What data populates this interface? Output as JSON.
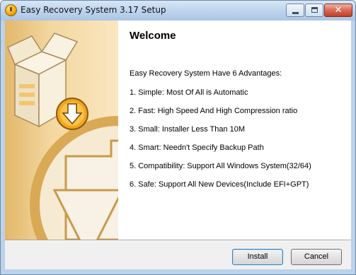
{
  "window": {
    "title": "Easy Recovery System 3.17 Setup",
    "icon": "installer-app-icon",
    "controls": {
      "minimize": "minimize-icon",
      "maximize": "maximize-icon",
      "close": "close-icon"
    }
  },
  "wizard": {
    "heading": "Welcome",
    "intro": "Easy Recovery System Have 6 Advantages:",
    "advantages": [
      "1. Simple: Most Of All is Automatic",
      "2. Fast: High Speed And High Compression ratio",
      "3. Small: Installer Less Than 10M",
      "4. Smart: Needn't Specify Backup Path",
      "5. Compatibility: Support All Windows System(32/64)",
      "6. Safe: Support All New Devices(Include EFI+GPT)"
    ],
    "sidebar_art": "box-with-download-arrow-illustration"
  },
  "buttons": {
    "install": "Install",
    "cancel": "Cancel"
  },
  "colors": {
    "sidebar_orange": "#f0c878",
    "arrow_fill": "#f6f2ea",
    "titlebar": "#bcd3ec"
  }
}
